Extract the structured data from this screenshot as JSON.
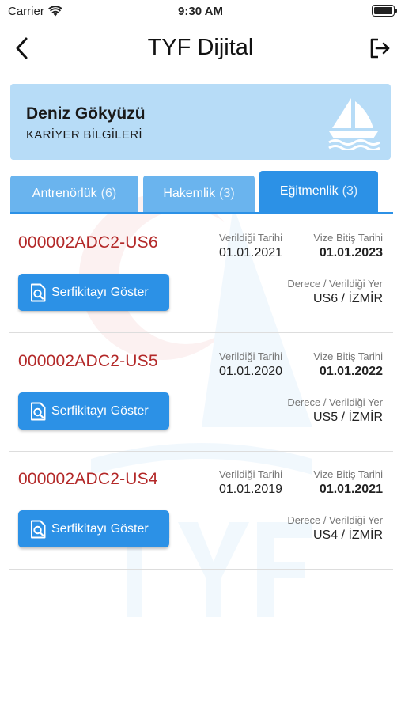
{
  "status_bar": {
    "carrier": "Carrier",
    "time": "9:30 AM"
  },
  "nav": {
    "title": "TYF Dijital"
  },
  "profile": {
    "name": "Deniz Gökyüzü",
    "subtitle": "KARİYER BİLGİLERİ"
  },
  "tabs": [
    {
      "label": "Antrenörlük",
      "count": "(6)",
      "active": false
    },
    {
      "label": "Hakemlik",
      "count": "(3)",
      "active": false
    },
    {
      "label": "Eğitmenlik",
      "count": "(3)",
      "active": true
    }
  ],
  "labels": {
    "issue_date": "Verildiği Tarihi",
    "visa_end": "Vize Bitiş Tarihi",
    "degree_place": "Derece / Verildiği Yer",
    "button": "Serfikitayı Göster"
  },
  "certificates": [
    {
      "code": "000002ADC2-US6",
      "issue_date": "01.01.2021",
      "visa_end": "01.01.2023",
      "degree_place": "US6 / İZMİR"
    },
    {
      "code": "000002ADC2-US5",
      "issue_date": "01.01.2020",
      "visa_end": "01.01.2022",
      "degree_place": "US5 / İZMİR"
    },
    {
      "code": "000002ADC2-US4",
      "issue_date": "01.01.2019",
      "visa_end": "01.01.2021",
      "degree_place": "US4 / İZMİR"
    }
  ],
  "colors": {
    "accent": "#2c91e6",
    "tab_inactive": "#6ab4ee",
    "profile_bg": "#b7dcf7",
    "code_red": "#b32828"
  },
  "icons": {
    "back": "chevron-left-icon",
    "logout": "logout-icon",
    "boat": "sailboat-icon",
    "certificate": "certificate-search-icon"
  }
}
